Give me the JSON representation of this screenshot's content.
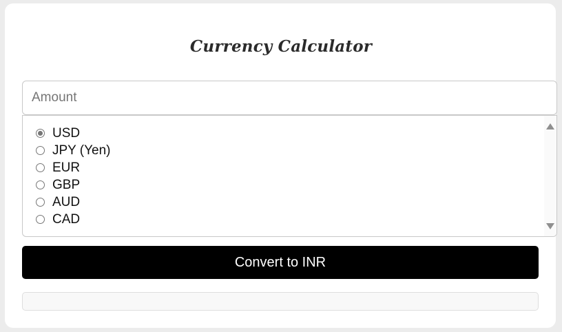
{
  "title": "Currency Calculator",
  "amount": {
    "placeholder": "Amount",
    "value": ""
  },
  "currencies": [
    {
      "label": "USD",
      "checked": true
    },
    {
      "label": "JPY (Yen)",
      "checked": false
    },
    {
      "label": "EUR",
      "checked": false
    },
    {
      "label": "GBP",
      "checked": false
    },
    {
      "label": "AUD",
      "checked": false
    },
    {
      "label": "CAD",
      "checked": false
    }
  ],
  "convert_button": "Convert to INR",
  "result": "",
  "colors": {
    "button_bg": "#000000",
    "page_bg": "#ececec",
    "card_bg": "#ffffff"
  }
}
